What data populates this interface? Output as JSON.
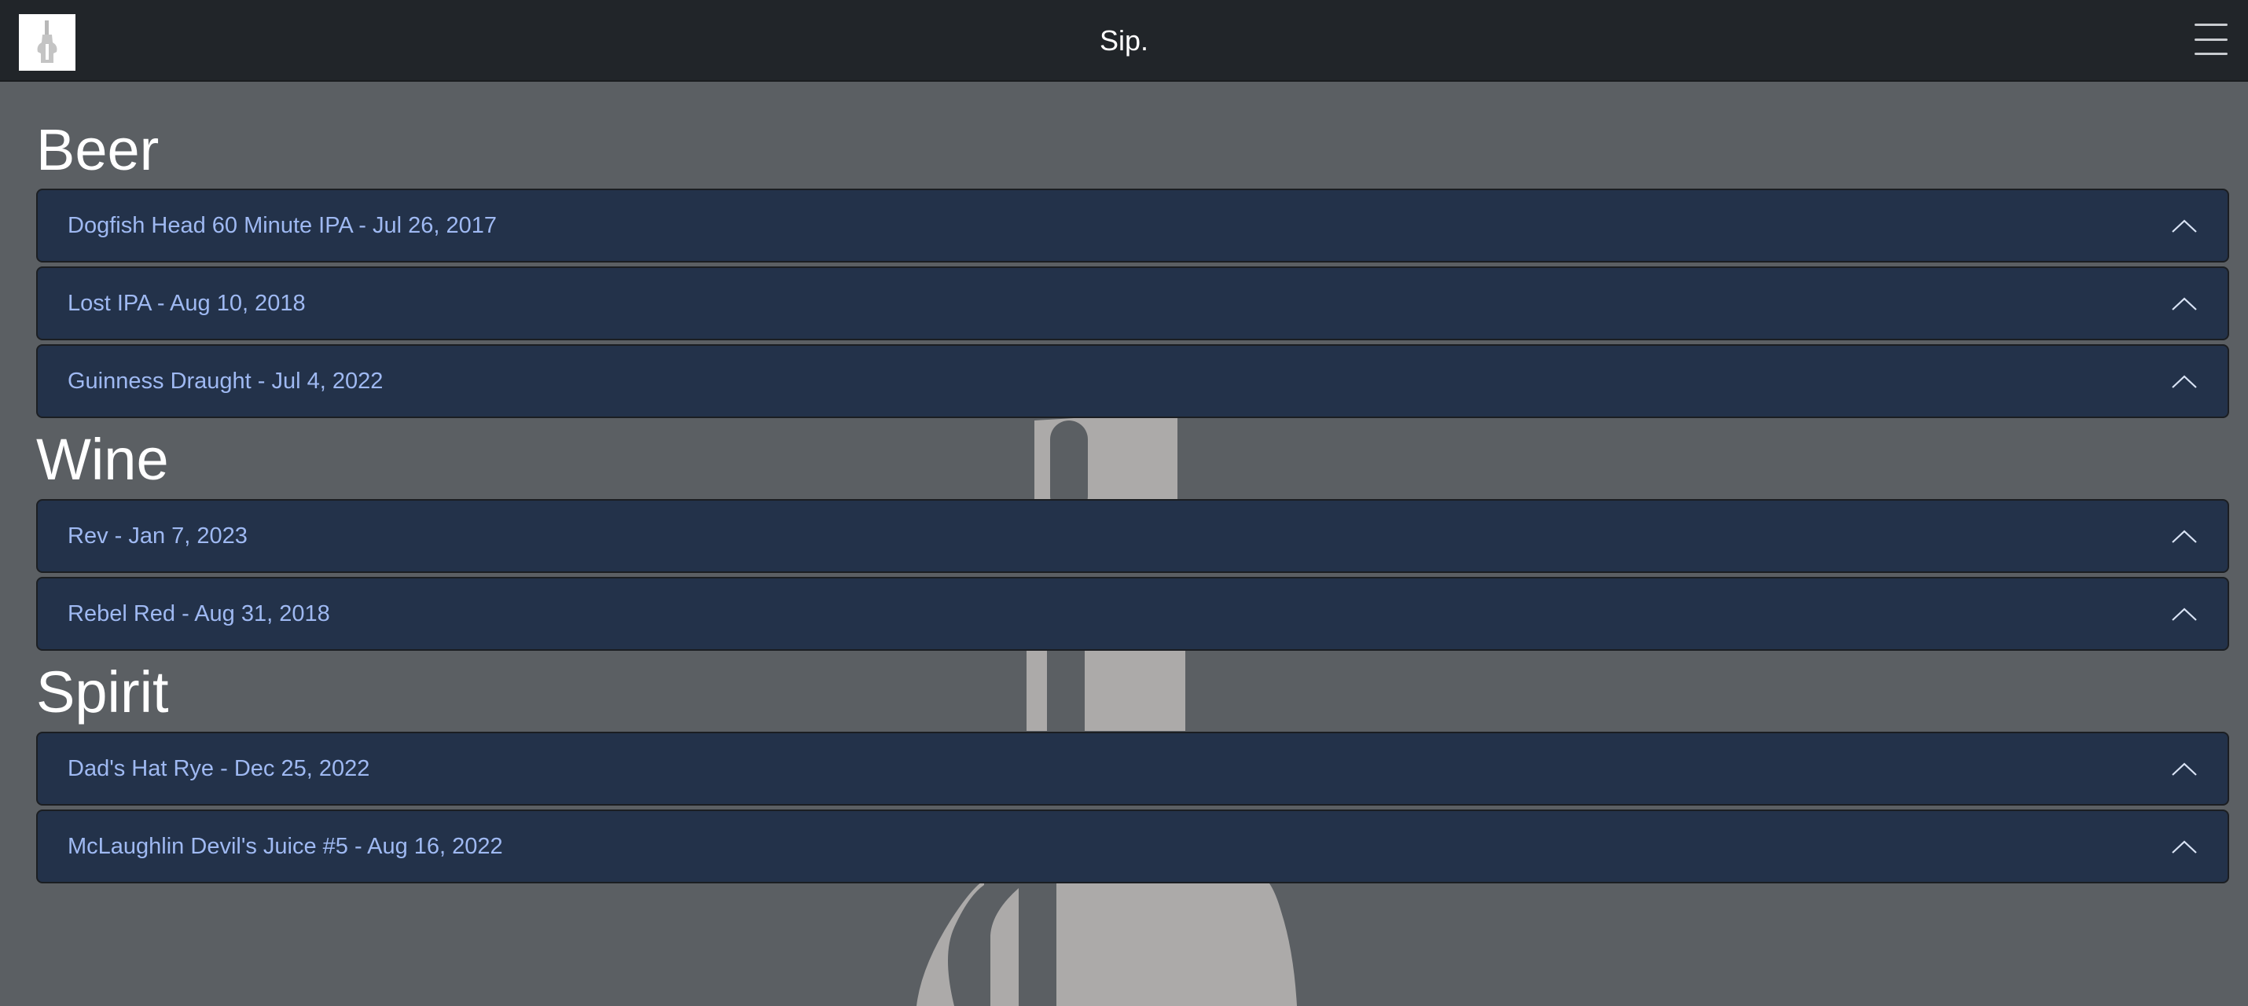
{
  "navbar": {
    "title": "Sip.",
    "logo_icon": "bottle-logo-icon",
    "menu_icon": "hamburger-menu-icon"
  },
  "sections": [
    {
      "title": "Beer",
      "items": [
        {
          "label": "Dogfish Head 60 Minute IPA - Jul 26, 2017"
        },
        {
          "label": "Lost IPA - Aug 10, 2018"
        },
        {
          "label": "Guinness Draught - Jul 4, 2022"
        }
      ]
    },
    {
      "title": "Wine",
      "items": [
        {
          "label": "Rev - Jan 7, 2023"
        },
        {
          "label": "Rebel Red - Aug 31, 2018"
        }
      ]
    },
    {
      "title": "Spirit",
      "items": [
        {
          "label": "Dad's Hat Rye - Dec 25, 2022"
        },
        {
          "label": "McLaughlin Devil's Juice #5 - Aug 16, 2022"
        }
      ]
    }
  ],
  "colors": {
    "page_background": "#5b5f63",
    "navbar_background": "#212529",
    "accordion_background": "#23324a",
    "accordion_text": "#9fb9f2",
    "bottle_illustration": "#acaaa9"
  }
}
